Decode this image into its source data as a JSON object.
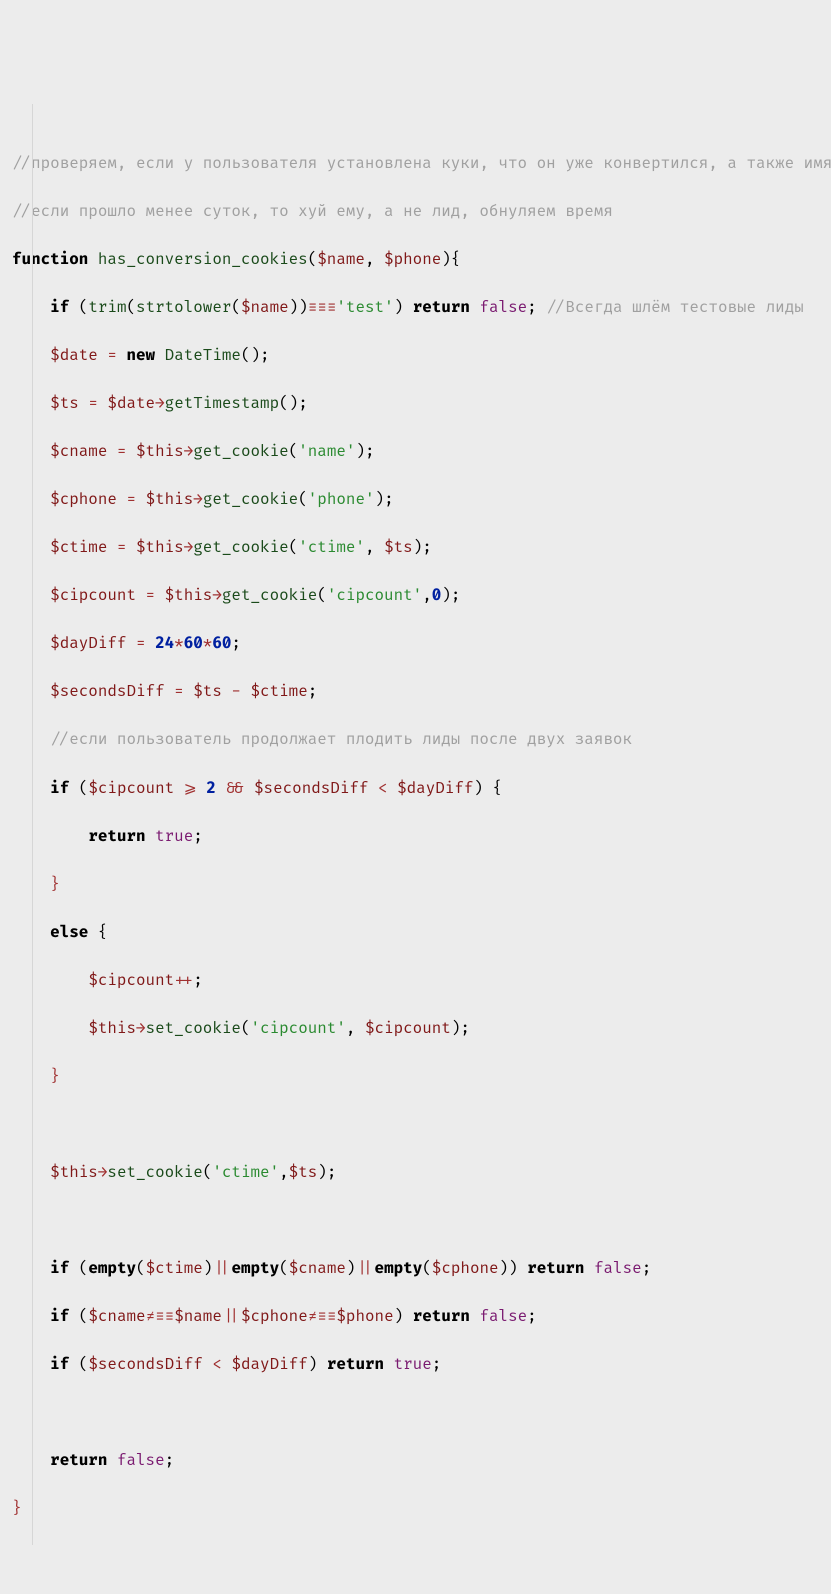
{
  "code": {
    "c1": "//проверяем, если у пользователя установлена куки, что он уже конвертился, а также имя и телефон, то сверяем время",
    "c2": "//если прошло менее суток, то хуй ему, а не лид, обнуляем время",
    "kw_function": "function",
    "fn_name": "has_conversion_cookies",
    "p_name": "$name",
    "p_phone": "$phone",
    "kw_if": "if",
    "fn_trim": "trim",
    "fn_strtolower": "strtolower",
    "op_eq3": "≡≡≡",
    "str_test": "'test'",
    "kw_return": "return",
    "bool_false": "false",
    "c3": "//Всегда шлём тестовые лиды",
    "v_date": "$date",
    "kw_new": "new",
    "cls_DateTime": "DateTime",
    "v_ts": "$ts",
    "op_arrow": "→",
    "m_getTimestamp": "getTimestamp",
    "v_cname": "$cname",
    "v_this": "$this",
    "m_get_cookie": "get_cookie",
    "str_name": "'name'",
    "v_cphone": "$cphone",
    "str_phone": "'phone'",
    "v_ctime": "$ctime",
    "str_ctime": "'ctime'",
    "v_cipcount": "$cipcount",
    "str_cipcount": "'cipcount'",
    "num_0": "0",
    "v_dayDiff": "$dayDiff",
    "num_24": "24",
    "num_60a": "60",
    "num_60b": "60",
    "v_secondsDiff": "$secondsDiff",
    "c4": "//если пользователь продолжает плодить лиды после двух заявок",
    "op_ge": "⩾",
    "num_2": "2",
    "op_and": "&&",
    "op_lt": "<",
    "bool_true": "true",
    "kw_else": "else",
    "op_inc": "++",
    "m_set_cookie": "set_cookie",
    "fn_empty": "empty",
    "op_or": "||",
    "op_neq3": "≠≡≡",
    "op_star": "*",
    "op_assign": " = ",
    "op_minus": " - "
  }
}
